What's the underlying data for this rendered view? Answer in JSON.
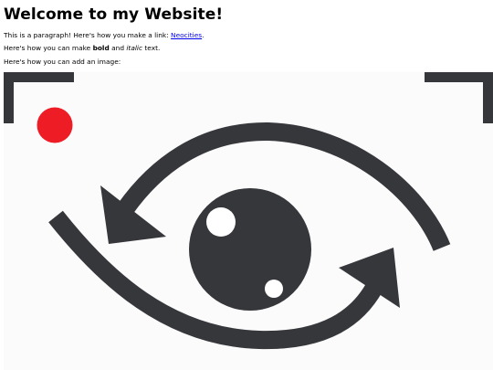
{
  "heading": "Welcome to my Website!",
  "paragraph1": {
    "before": "This is a paragraph! Here's how you make a link: ",
    "link_text": "Neocities",
    "after": "."
  },
  "paragraph2": {
    "before": "Here's how you can make ",
    "bold": "bold",
    "middle": " and ",
    "italic": "italic",
    "after": " text."
  },
  "paragraph3": "Here's how you can add an image:",
  "image": {
    "icon": "eye-with-arrows-icon",
    "colors": {
      "dark": "#36373b",
      "record_dot": "#ee1c25",
      "background": "#fbfbfc"
    }
  },
  "colors": {
    "link": "#0000ee",
    "text": "#000000"
  }
}
